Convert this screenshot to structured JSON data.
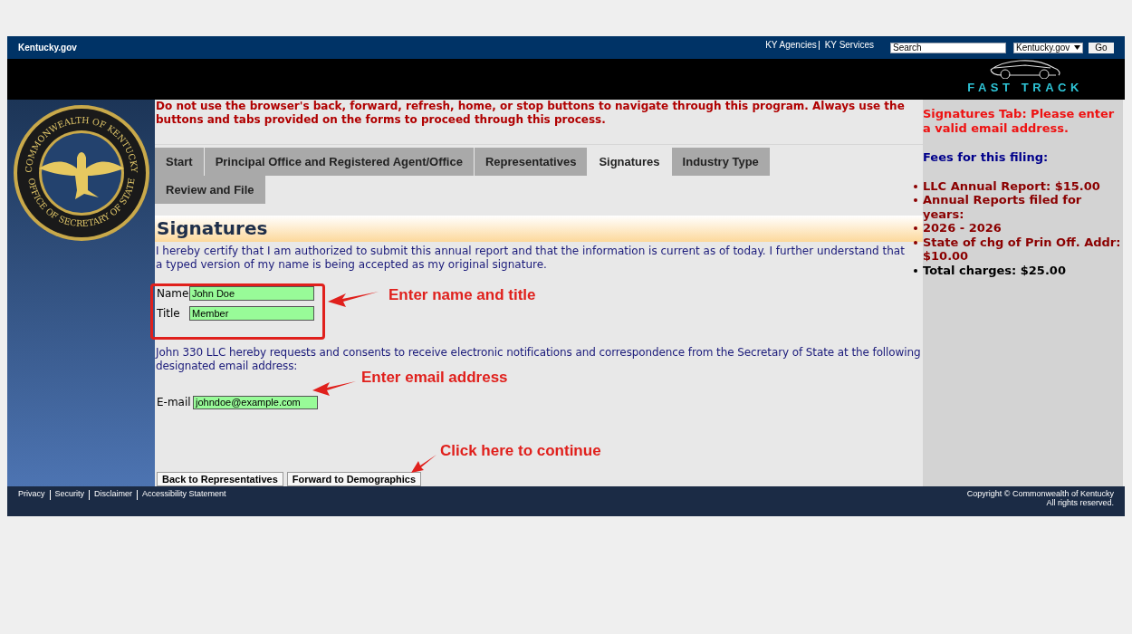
{
  "top_bar": {
    "logo": "Kentucky.gov",
    "links": [
      "KY Agencies",
      "KY Services"
    ],
    "search": {
      "value": "Search"
    },
    "scope_select": "Kentucky.gov",
    "go_button": "Go"
  },
  "banner": {
    "logo_text": "FAST TRACK"
  },
  "seal": {
    "top_text": "COMMONWEALTH OF KENTUCKY",
    "bottom_text": "OFFICE OF SECRETARY OF STATE"
  },
  "warning": "Do not use the browser's back, forward, refresh, home, or stop buttons to navigate through this program.  Always use the buttons and tabs provided on the forms to proceed through this process.",
  "tabs": [
    {
      "label": "Start",
      "selected": false
    },
    {
      "label": "Principal Office and Registered Agent/Office",
      "selected": false
    },
    {
      "label": "Representatives",
      "selected": false
    },
    {
      "label": "Signatures",
      "selected": true
    },
    {
      "label": "Industry Type",
      "selected": false
    },
    {
      "label": "Review and File",
      "selected": false
    }
  ],
  "section_title": "Signatures",
  "certify_text": "I hereby certify that I am authorized to submit this annual report and that the information is current as of today.  I further understand that a typed version of my name is being accepted as my original signature.",
  "signature_fields": [
    {
      "label": "Name",
      "value": "John Doe"
    },
    {
      "label": "Title",
      "value": "Member"
    }
  ],
  "consent_text": "John 330 LLC hereby requests and consents to receive electronic notifications and correspondence from the Secretary of State at the following designated email address:",
  "email_field": {
    "label": "E-mail",
    "value": "johndoe@example.com"
  },
  "buttons": [
    "Back to Representatives",
    "Forward to Demographics"
  ],
  "side_panel": {
    "error": "Signatures Tab: Please enter a valid email address.",
    "fees_title": "Fees for this filing:",
    "fees": [
      {
        "text": "LLC Annual Report: $15.00",
        "kind": "fee"
      },
      {
        "text": "Annual Reports filed for years:",
        "kind": "fee"
      },
      {
        "text": "2026 - 2026",
        "kind": "fee"
      },
      {
        "text": "State of chg of Prin Off. Addr: $10.00",
        "kind": "fee"
      },
      {
        "text": "Total charges: $25.00",
        "kind": "total"
      }
    ]
  },
  "footer": {
    "links": [
      "Privacy",
      "Security",
      "Disclaimer",
      "Accessibility Statement"
    ],
    "copyright": [
      "Copyright © Commonwealth of Kentucky",
      "All rights reserved."
    ]
  },
  "annotations": [
    "Enter name and title",
    "Enter email address",
    "Click here to continue"
  ]
}
